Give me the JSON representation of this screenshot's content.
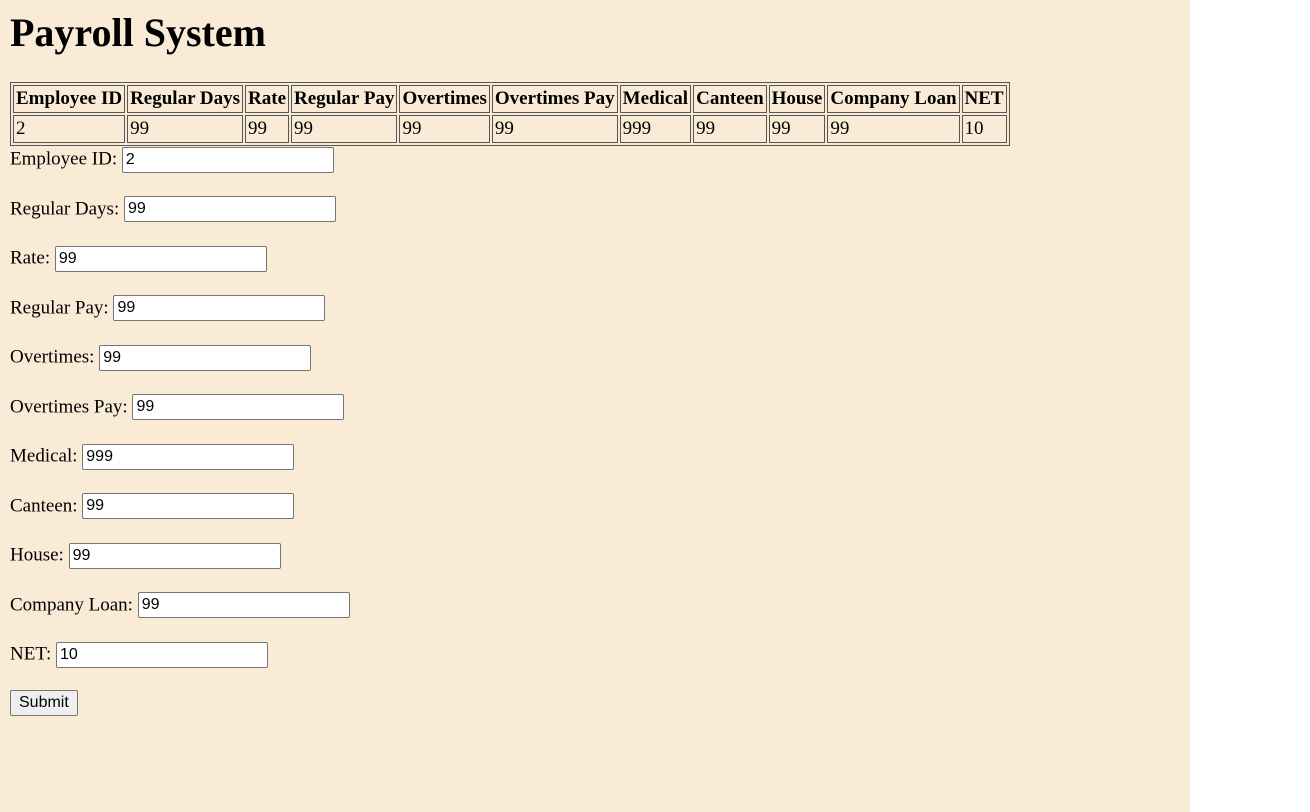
{
  "page": {
    "title": "Payroll System",
    "background_color": "#faebd7"
  },
  "table": {
    "headers": [
      "Employee ID",
      "Regular Days",
      "Rate",
      "Regular Pay",
      "Overtimes",
      "Overtimes Pay",
      "Medical",
      "Canteen",
      "House",
      "Company Loan",
      "NET"
    ],
    "rows": [
      [
        "2",
        "99",
        "99",
        "99",
        "99",
        "99",
        "999",
        "99",
        "99",
        "99",
        "10"
      ]
    ]
  },
  "form": {
    "fields": [
      {
        "label": "Employee ID:",
        "value": "2"
      },
      {
        "label": "Regular Days:",
        "value": "99"
      },
      {
        "label": "Rate:",
        "value": "99"
      },
      {
        "label": "Regular Pay:",
        "value": "99"
      },
      {
        "label": "Overtimes:",
        "value": "99"
      },
      {
        "label": "Overtimes Pay:",
        "value": "99"
      },
      {
        "label": "Medical:",
        "value": "999"
      },
      {
        "label": "Canteen:",
        "value": "99"
      },
      {
        "label": "House:",
        "value": "99"
      },
      {
        "label": "Company Loan:",
        "value": "99"
      },
      {
        "label": "NET:",
        "value": "10"
      }
    ],
    "submit_label": "Submit"
  }
}
